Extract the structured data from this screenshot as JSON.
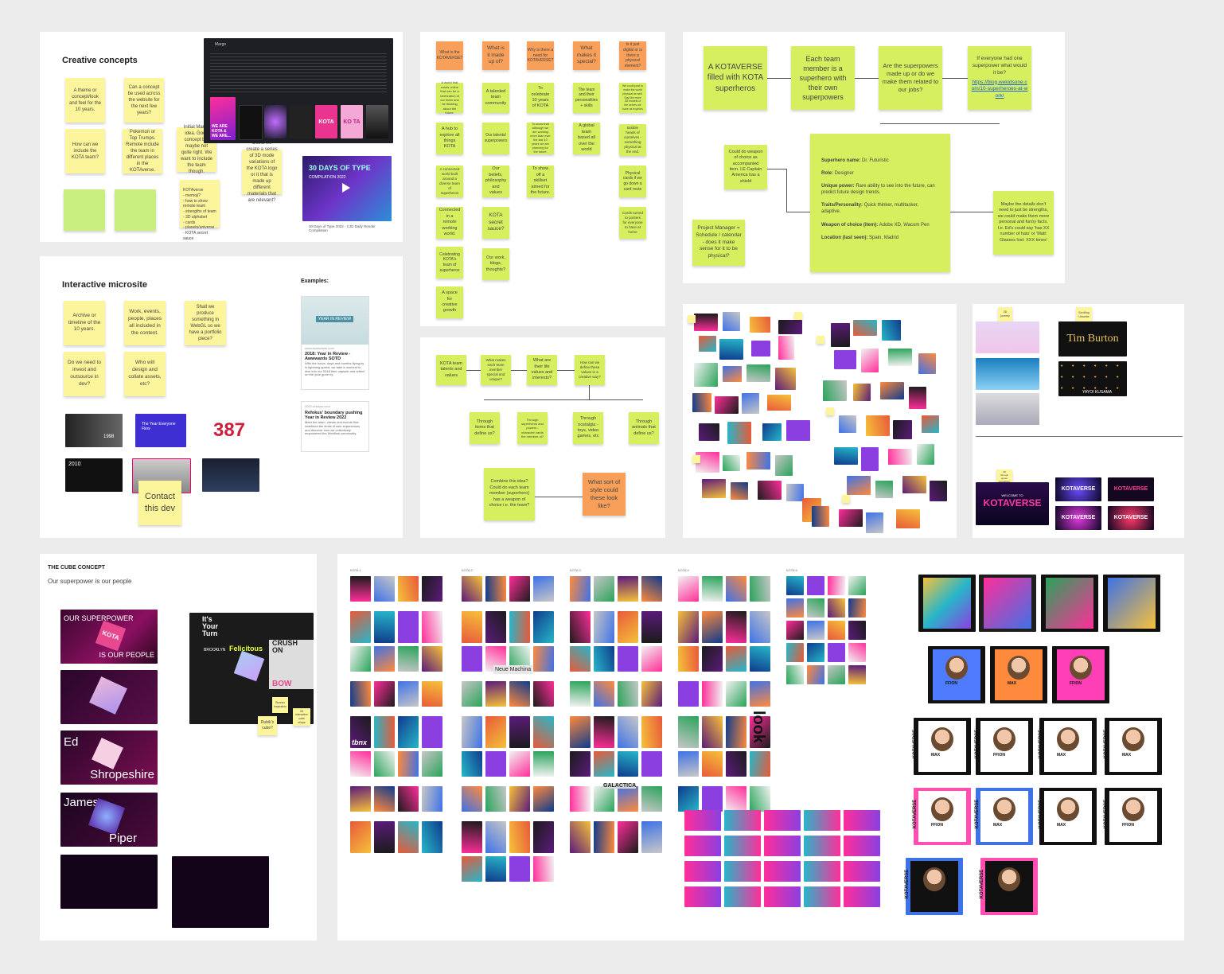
{
  "creative": {
    "title": "Creative concepts",
    "notes": [
      "A theme or concept/look and feel for the 10 years.",
      "Can a concept be used across the website for the next few years?",
      "How can we include the KOTA team?",
      "Pokemon or Top Trumps. Remote include the team in different places in the KOTAverse.",
      "Initial Margo idea. Good concept but maybe not quite right. We want to include the team though.",
      "Could we create a series of 3D mode variations of the KOTA logo or it that is made up different materials that are relevant?",
      "KOTAverse\n- memoji?\n- how to show remote team\n- strengths of team\n- 3D alphabet\n- cards\n- planets/universe\n- KOTA secret sauce"
    ],
    "dark_header": "Margo",
    "video_title": "30 DAYS OF TYPE",
    "video_sub": "COMPILATION 2022",
    "video_caption": "30 Days of Type 2022 - CJD Daily Render Compilation",
    "poster_texts": [
      "WE ARE KOTA & WE ARE...",
      "KOTA",
      "KO TA"
    ]
  },
  "micro": {
    "title": "Interactive microsite",
    "notes": [
      "Archive or timeline of the 10 years.",
      "Work, events, people, places all included in the content.",
      "Shall we produce something in WebGL so we have a portfolio piece?",
      "Do we need to invest and outsource in dev?",
      "Who will design and collate assets, etc?",
      "Contact this dev"
    ],
    "examples_label": "Examples:",
    "ex1_badge": "YEAR IN REVIEW",
    "ex1_url": "www.awwwards.com",
    "ex1_title": "2018: Year in Review - Awwwards SOTD",
    "ex1_desc": "With the hours, days and months flying by in lightning speed, we take a moment to dive into our 2018 time capsule and reflect on the year gone by.",
    "ex2_url": "2022.refokus.com",
    "ex2_title": "Refokus' boundary pushing Year in Review 2022",
    "ex2_desc": "Meet the team, clients and events that redefined the limits of web experiences and discover how we collectively empowered the Webflow community.",
    "thumb_texts": [
      "1998",
      "The Year Everyone Flew",
      "387",
      "2010"
    ]
  },
  "questions": {
    "headers": [
      "What is the KOTAVERSE?",
      "What is it made up of?",
      "Why is there a need for KOTAVERSE?",
      "What makes it special?",
      "Is it just digital or is there a physical element?"
    ],
    "col1": [
      "A world that exists online that can be a celebration of our team and be thinking about the future.",
      "A hub to explore all things KOTA",
      "A connected world built around a diverse team of superheros",
      "Connected in a remote working world.",
      "Celebrating KOTA's team of superheros",
      "A space for creative growth"
    ],
    "col2": [
      "A talented team community",
      "Our talents/ superpowers",
      "Our beliefs, philosophy and values",
      "KOTA secret sauce?",
      "Our work, blogs, thoughts?"
    ],
    "col3": [
      "To celebrate 10 years of KOTA",
      "To show that although we are working more than ever the last 10 years we are planning for the future.",
      "To show off a skillset aimed for the future."
    ],
    "col4": [
      "The team and their personalities + skills",
      "A global team based all over the world"
    ],
    "col5": [
      "We could post to make the world physical as well. Say like more 3D models of the selves we have as trophies",
      "Bobble heads of ourselves - something physical at the end.",
      "Physical cards if we go down a card route",
      "Cards turned to posters for everyone to have at home"
    ]
  },
  "flow": {
    "row1": [
      "KOTA team talents and values",
      "What makes each team member special and unique?",
      "What are their life values and interests?",
      "How can we define these values in a creative way?"
    ],
    "row2": [
      "Through items that define us?",
      "Through superheros and powers - character cards the member of?",
      "Through nostalgia - toys, video games, etc",
      "Through animals that define us?"
    ],
    "combine": "Combine this idea? Could do each team member (superhero) has a weapon of choice i.e. the team?",
    "style": "What sort of style could these look like?"
  },
  "superhero": {
    "row": [
      "A KOTAVERSE filled with KOTA superheros",
      "Each team member is a superhero with their own superpowers",
      "Are the superpowers made up or do we make them related to our jobs?"
    ],
    "q4_text": "If everyone had one superpower what would it be?",
    "q4_link": "https://blog.wekidsone.com/10-superheroes-at-work/",
    "weapon": "Could do weapon of choice as accompanied item. I.E Captain America has a shield",
    "pm": "Project Manager = Schedule / calendar - does it make sense for it to be physical?",
    "maybe": "Maybe the details don't need to just be strengths, we could make them more personal and funny facts. I.e. Ed's could say 'has XX number of hats' or 'Matt: Glasses lost: XXX times'",
    "profile": [
      {
        "k": "Superhero name:",
        "v": " Dr. Futuristic"
      },
      {
        "k": "Role:",
        "v": " Designer"
      },
      {
        "k": "Unique power:",
        "v": " Rare ability to see into the future, can predict future design trends."
      },
      {
        "k": "Traits/Personality:",
        "v": " Quick thinker, multitasker, adaptive."
      },
      {
        "k": "Weapon of choice (item):",
        "v": " Adobe XD, Wacom Pen"
      },
      {
        "k": "Location (last seen):",
        "v": " Spain, Madrid"
      }
    ]
  },
  "refs": {
    "note1": "3D journey",
    "note2": "Scrolling Urbanite",
    "tim": "Tim Burton",
    "yayoi": "YAYOI KUSAMA",
    "kota_note": "3D through space something",
    "welcome": "WELCOME TO",
    "kotaverse": "KOTAVERSE"
  },
  "cube": {
    "title": "THE CUBE CONCEPT",
    "subtitle": "Our superpower is our people",
    "card1_top": "OUR SUPERPOWER",
    "card1_bottom": "IS OUR PEOPLE",
    "card1_cube": "KOTA",
    "card3_a": "Ed",
    "card3_b": "Shropeshire",
    "card4_a": "James",
    "card4_b": "Piper",
    "note1": "Bureau Inspiration",
    "note2": "Rubik's cube?",
    "note3": "3D interactive cube shape",
    "collage_texts": [
      "It's Your Turn",
      "Felicitous",
      "CRUSH ON",
      "BOW",
      "BROOKLYN"
    ]
  },
  "moodboard": {
    "group_labels": [
      "KOTA 1",
      "KOTA 2",
      "KOTA 3",
      "KOTA 4",
      "KOTA 5"
    ],
    "poster_words": [
      "Neue Machina",
      "tbnx",
      "REALITY",
      "GALACTICA",
      "ULTIMATE",
      "look"
    ],
    "card_brand": "KOTAVERSE",
    "card_names": [
      "MAX",
      "FFION",
      "MAX",
      "MAX",
      "FFION",
      "MAX",
      "FFION",
      "MAX",
      "FFION",
      "MAX"
    ]
  },
  "colors": {
    "yellow": "#fdf59c",
    "green": "#d5ef5f",
    "orange": "#f8a05a",
    "pink": "#ff2e9a",
    "blue": "#3f72e6"
  }
}
